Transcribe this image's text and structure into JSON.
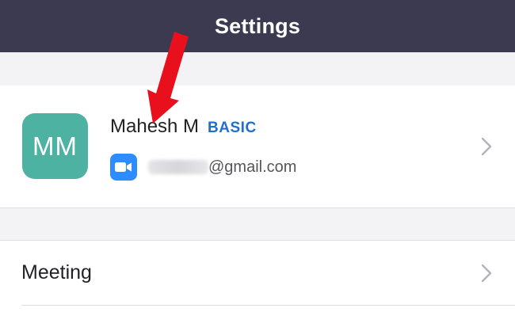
{
  "header": {
    "title": "Settings"
  },
  "profile": {
    "avatar_initials": "MM",
    "avatar_color": "#4db2a2",
    "name": "Mahesh M",
    "plan": "BASIC",
    "plan_color": "#1f6fd1",
    "email_domain": "@gmail.com",
    "email_local_part_redacted": true,
    "account_icon": "zoom-video-camera-icon"
  },
  "menu": {
    "items": [
      {
        "label": "Meeting",
        "icon": "chevron-right-icon"
      }
    ]
  },
  "colors": {
    "header_bg": "#3b3a50",
    "page_bg": "#f3f3f5",
    "annotation_arrow": "#e8101c"
  }
}
